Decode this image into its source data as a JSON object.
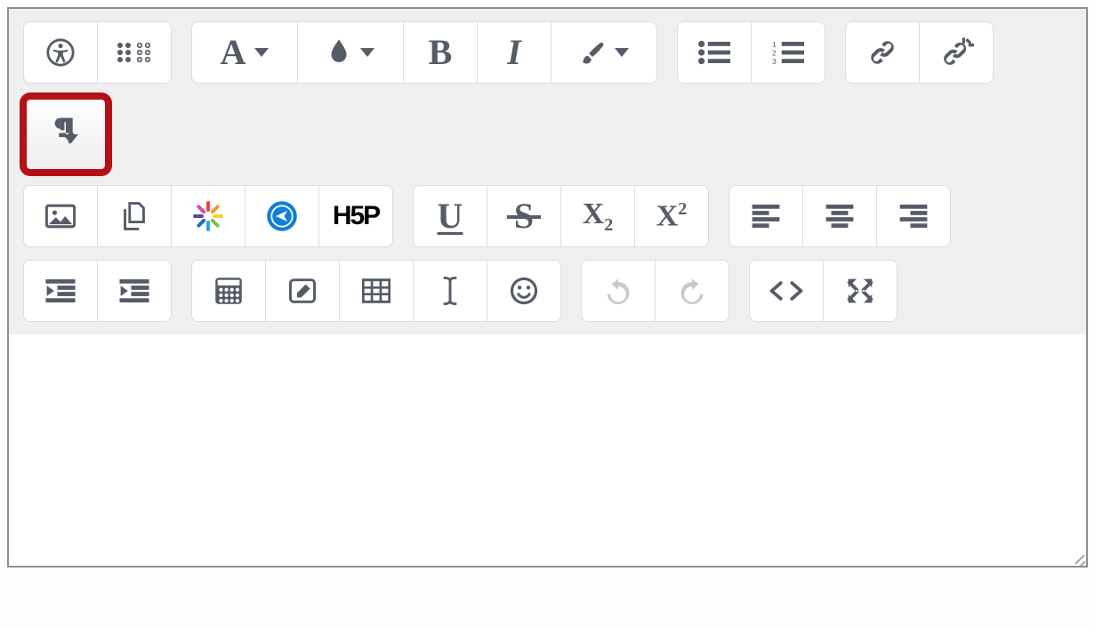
{
  "toolbar": {
    "row1": {
      "group_access": {
        "accessibility": "accessibility-icon",
        "braille": "screen-reader-icon"
      },
      "group_font": {
        "fontfamily": "A",
        "fontcolor": "drop-icon",
        "bold": "B",
        "italic": "I",
        "more": "brush-icon"
      },
      "group_list": {
        "ul": "unordered-list-icon",
        "ol": "ordered-list-icon"
      },
      "group_link": {
        "link": "link-icon",
        "unlink": "unlink-icon"
      }
    },
    "row2": {
      "group_toggle": {
        "toggle": "paragraph-rtl-icon"
      }
    },
    "row3": {
      "group_media": {
        "image": "image-icon",
        "files": "files-icon",
        "spinner": "loading-icon",
        "telegram": "telegram-icon",
        "h5p": "H5P"
      },
      "group_text": {
        "underline": "U",
        "strike": "S",
        "subscript_base": "X",
        "subscript_sub": "2",
        "superscript_base": "X",
        "superscript_sup": "2"
      },
      "group_align": {
        "left": "align-left-icon",
        "center": "align-center-icon",
        "right": "align-right-icon"
      }
    },
    "row4": {
      "group_indent": {
        "outdent": "outdent-icon",
        "indent": "indent-icon"
      },
      "group_insert": {
        "grid": "grid-icon",
        "note": "edit-note-icon",
        "table": "table-icon",
        "cursor": "text-cursor-icon",
        "emoji": "smile-icon"
      },
      "group_history": {
        "undo": "undo-icon",
        "redo": "redo-icon"
      },
      "group_view": {
        "source": "code-icon",
        "fullscreen": "fullscreen-icon"
      }
    }
  },
  "editor": {
    "content": ""
  }
}
